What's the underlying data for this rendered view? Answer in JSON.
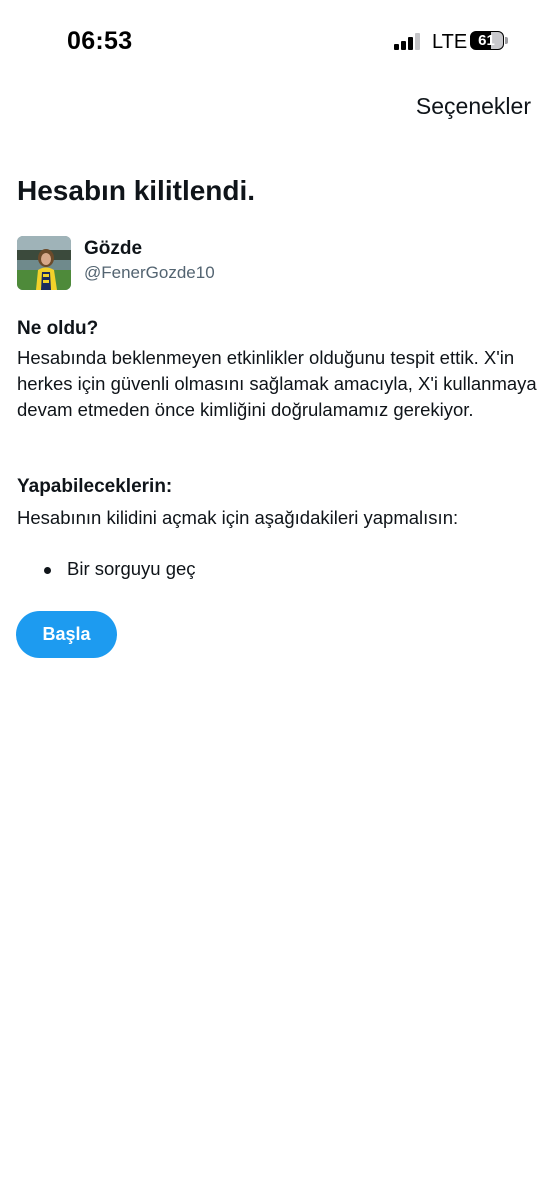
{
  "status_bar": {
    "time": "06:53",
    "network": "LTE",
    "battery_level": "61"
  },
  "header": {
    "options_label": "Seçenekler"
  },
  "page": {
    "title": "Hesabın kilitlendi."
  },
  "account": {
    "display_name": "Gözde",
    "handle": "@FenerGozde10"
  },
  "what_happened": {
    "heading": "Ne oldu?",
    "text": "Hesabında beklenmeyen etkinlikler olduğunu tespit ettik. X'in herkes için güvenli olmasını sağlamak amacıyla, X'i kullanmaya devam etmeden önce kimliğini doğrulamamız gerekiyor."
  },
  "what_you_can_do": {
    "heading": "Yapabileceklerin:",
    "text": "Hesabının kilidini açmak için aşağıdakileri yapmalısın:",
    "items": [
      "Bir sorguyu geç"
    ]
  },
  "actions": {
    "start_label": "Başla"
  },
  "colors": {
    "accent": "#1d9bf0",
    "text_primary": "#0f1419",
    "text_secondary": "#536471"
  },
  "icons": {
    "signal": "cellular-signal-icon",
    "battery": "battery-icon",
    "avatar": "profile-photo"
  }
}
